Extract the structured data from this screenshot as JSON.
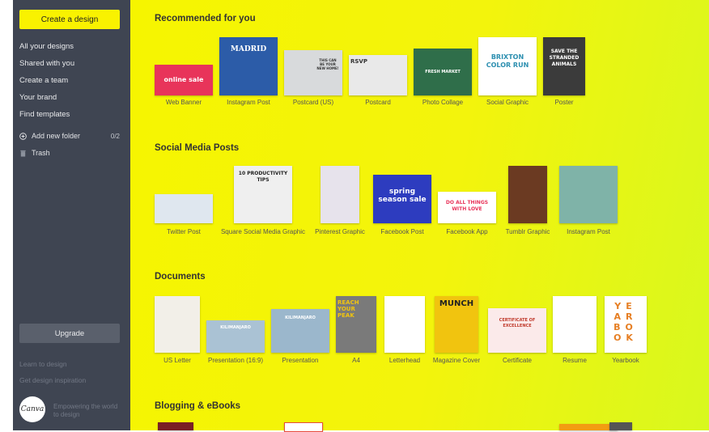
{
  "sidebar": {
    "create_label": "Create a design",
    "nav": [
      "All your designs",
      "Shared with you",
      "Create a team",
      "Your brand",
      "Find templates"
    ],
    "add_folder": {
      "label": "Add new folder",
      "count": "0/2"
    },
    "trash": "Trash",
    "upgrade": "Upgrade",
    "learn": "Learn to design",
    "inspiration": "Get design inspiration",
    "logo": "Canva",
    "tagline": "Empowering the world to design"
  },
  "sections": [
    {
      "title": "Recommended for you",
      "items": [
        {
          "label": "Web Banner",
          "color": "#e8345a",
          "thumb_text": "online sale"
        },
        {
          "label": "Instagram Post",
          "color": "#2c5ca8",
          "thumb_text": "MADRID"
        },
        {
          "label": "Postcard (US)",
          "color": "#d8dadc",
          "thumb_text": "THIS CAN BE YOUR NEW HOME!"
        },
        {
          "label": "Postcard",
          "color": "#e9e9e9",
          "thumb_text": "RSVP"
        },
        {
          "label": "Photo Collage",
          "color": "#2f6e4a",
          "thumb_text": "FRESH MARKET"
        },
        {
          "label": "Social Graphic",
          "color": "#ffffff",
          "thumb_text": "BRIXTON COLOR RUN"
        },
        {
          "label": "Poster",
          "color": "#3b3b3b",
          "thumb_text": "SAVE THE STRANDED ANIMALS"
        }
      ]
    },
    {
      "title": "Social Media Posts",
      "items": [
        {
          "label": "Twitter Post",
          "color": "#dfe7ef",
          "thumb_text": ""
        },
        {
          "label": "Square Social Media Graphic",
          "color": "#efefef",
          "thumb_text": "10 PRODUCTIVITY TIPS"
        },
        {
          "label": "Pinterest Graphic",
          "color": "#e7e3ec",
          "thumb_text": ""
        },
        {
          "label": "Facebook Post",
          "color": "#2d3cbf",
          "thumb_text": "spring season sale"
        },
        {
          "label": "Facebook App",
          "color": "#ffffff",
          "thumb_text": "DO ALL THINGS WITH LOVE"
        },
        {
          "label": "Tumblr Graphic",
          "color": "#6b3a22",
          "thumb_text": ""
        },
        {
          "label": "Instagram Post",
          "color": "#7fb3a8",
          "thumb_text": ""
        }
      ]
    },
    {
      "title": "Documents",
      "items": [
        {
          "label": "US Letter",
          "color": "#f2efe8",
          "thumb_text": ""
        },
        {
          "label": "Presentation (16:9)",
          "color": "#aac2d4",
          "thumb_text": "KILIMANJARO"
        },
        {
          "label": "Presentation",
          "color": "#9bb7cc",
          "thumb_text": "KILIMANJARO"
        },
        {
          "label": "A4",
          "color": "#7a7a7a",
          "thumb_text": "REACH YOUR PEAK"
        },
        {
          "label": "Letterhead",
          "color": "#ffffff",
          "thumb_text": ""
        },
        {
          "label": "Magazine Cover",
          "color": "#f1c40f",
          "thumb_text": "MUNCH"
        },
        {
          "label": "Certificate",
          "color": "#fbeaea",
          "thumb_text": "CERTIFICATE OF EXCELLENCE"
        },
        {
          "label": "Resume",
          "color": "#ffffff",
          "thumb_text": ""
        },
        {
          "label": "Yearbook",
          "color": "#ffffff",
          "thumb_text": "YEARBOOK"
        }
      ]
    },
    {
      "title": "Blogging & eBooks",
      "items": []
    }
  ]
}
